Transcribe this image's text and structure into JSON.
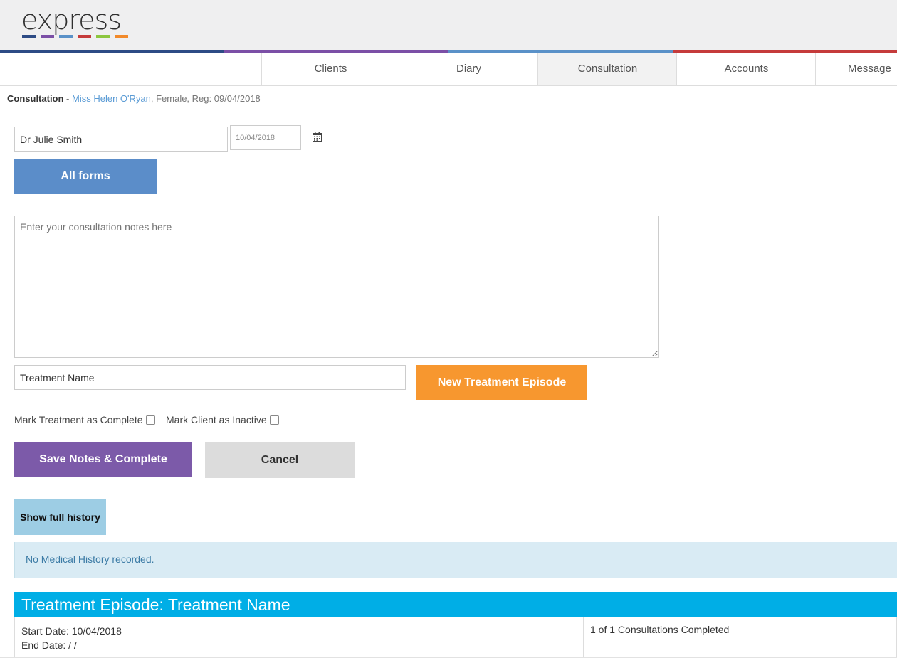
{
  "app": {
    "logo_text": "express",
    "logo_bar_colors": [
      "#2d4b85",
      "#7b4fa6",
      "#5a91c8",
      "#c53b3b",
      "#8cc63f",
      "#f28a2a"
    ],
    "accent_line_colors": [
      "#2d4b85",
      "#7b4fa6",
      "#5a91c8",
      "#c53b3b"
    ]
  },
  "nav": {
    "tabs": [
      {
        "label": "Clients",
        "active": false
      },
      {
        "label": "Diary",
        "active": false
      },
      {
        "label": "Consultation",
        "active": true
      },
      {
        "label": "Accounts",
        "active": false
      },
      {
        "label": "Message",
        "active": false
      }
    ]
  },
  "breadcrumb": {
    "section": "Consultation",
    "separator": " - ",
    "client_name": "Miss Helen O'Ryan",
    "details": ", Female, Reg: 09/04/2018"
  },
  "form": {
    "clinician_value": "Dr Julie Smith",
    "date_value": "10/04/2018",
    "calendar_icon": "calendar-icon",
    "all_forms_label": "All forms",
    "notes_placeholder": "Enter your consultation notes here",
    "treatment_name_value": "Treatment Name",
    "new_episode_label": "New Treatment Episode",
    "mark_treatment_complete_label": "Mark Treatment as Complete",
    "mark_client_inactive_label": "Mark Client as Inactive",
    "save_label": "Save Notes & Complete",
    "cancel_label": "Cancel"
  },
  "history": {
    "show_full_history_label": "Show full history",
    "message": "No Medical History recorded."
  },
  "episode": {
    "title": "Treatment Episode: Treatment Name",
    "start_date": "Start Date: 10/04/2018",
    "end_date": "End Date: / /",
    "consultations": "1 of 1 Consultations Completed"
  },
  "colors": {
    "all_forms_button": "#5b8dc9",
    "new_episode_button": "#f7972f",
    "save_button": "#7c5aa9",
    "cancel_button": "#dcdcdc",
    "history_button": "#9dcde4",
    "episode_header": "#00aee6"
  }
}
